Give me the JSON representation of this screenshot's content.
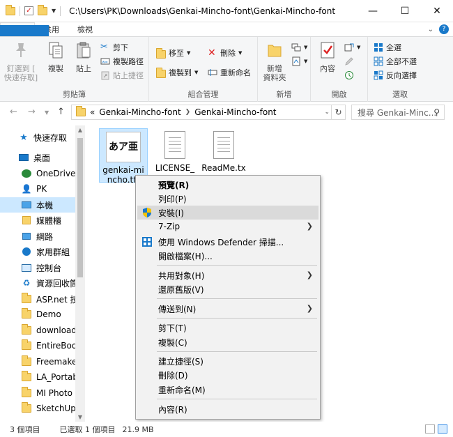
{
  "window": {
    "title": "C:\\Users\\PK\\Downloads\\Genkai-Mincho-font\\Genkai-Mincho-font",
    "minimize": "—",
    "maximize": "☐",
    "close": "✕"
  },
  "tabs": [
    "檔案",
    "常用",
    "共用",
    "檢視"
  ],
  "ribbon": {
    "clipboard": {
      "label": "剪貼簿",
      "pin": "釘選到[快速存取]",
      "pin_line1": "釘選到 [",
      "pin_line2": "快速存取]",
      "copy": "複製",
      "paste": "貼上",
      "cut": "剪下",
      "copy_path": "複製路徑",
      "paste_shortcut": "貼上捷徑"
    },
    "organize": {
      "label": "組合管理",
      "move_to": "移至",
      "copy_to": "複製到",
      "delete": "刪除",
      "rename": "重新命名"
    },
    "new": {
      "label": "新增",
      "new_folder_line1": "新增",
      "new_folder_line2": "資料夾"
    },
    "open": {
      "label": "開啟",
      "properties": "內容"
    },
    "select": {
      "label": "選取",
      "select_all": "全選",
      "select_none": "全部不選",
      "invert": "反向選擇"
    }
  },
  "address": {
    "overflow": "«",
    "crumbs": [
      "Genkai-Mincho-font",
      "Genkai-Mincho-font"
    ],
    "search_placeholder": "搜尋 Genkai-Minc...",
    "search_display": "搜尋 Genkai-Minc..."
  },
  "sidebar": {
    "items": [
      {
        "label": "快速存取",
        "icon": "star-icon"
      },
      {
        "label": "桌面",
        "icon": "desktop-icon"
      },
      {
        "label": "OneDrive",
        "icon": "onedrive-icon"
      },
      {
        "label": "PK",
        "icon": "user-icon"
      },
      {
        "label": "本機",
        "icon": "computer-icon"
      },
      {
        "label": "媒體櫃",
        "icon": "library-icon"
      },
      {
        "label": "網路",
        "icon": "network-icon"
      },
      {
        "label": "家用群組",
        "icon": "homegroup-icon"
      },
      {
        "label": "控制台",
        "icon": "control-panel-icon"
      },
      {
        "label": "資源回收筒",
        "icon": "recycle-bin-icon"
      },
      {
        "label": "ASP.net 技",
        "icon": "folder-icon"
      },
      {
        "label": "Demo",
        "icon": "folder-icon"
      },
      {
        "label": "download",
        "icon": "folder-icon"
      },
      {
        "label": "EntireBook",
        "icon": "folder-icon"
      },
      {
        "label": "Freemake_",
        "icon": "folder-icon"
      },
      {
        "label": "LA_Portabl",
        "icon": "folder-icon"
      },
      {
        "label": "MI Photo",
        "icon": "folder-icon"
      },
      {
        "label": "SketchUp",
        "icon": "folder-icon"
      }
    ]
  },
  "files": [
    {
      "name_line1": "genkai-mi",
      "name_line2": "ncho.ttf",
      "preview": "あア亜",
      "selected": true
    },
    {
      "name_line1": "LICENSE_",
      "name_line2": "",
      "selected": false
    },
    {
      "name_line1": "ReadMe.tx",
      "name_line2": "",
      "selected": false
    }
  ],
  "context_menu": {
    "items": [
      {
        "label": "預覽(R)"
      },
      {
        "label": "列印(P)"
      },
      {
        "label": "安裝(I)"
      },
      {
        "label": "7-Zip"
      },
      {
        "label": "使用 Windows Defender 掃描..."
      },
      {
        "label": "開啟檔案(H)..."
      },
      {
        "label": "共用對象(H)"
      },
      {
        "label": "還原舊版(V)"
      },
      {
        "label": "傳送到(N)"
      },
      {
        "label": "剪下(T)"
      },
      {
        "label": "複製(C)"
      },
      {
        "label": "建立捷徑(S)"
      },
      {
        "label": "刪除(D)"
      },
      {
        "label": "重新命名(M)"
      },
      {
        "label": "內容(R)"
      }
    ]
  },
  "status": {
    "count": "3 個項目",
    "selected": "已選取 1 個項目",
    "size": "21.9 MB"
  },
  "colors": {
    "accent": "#1979ca",
    "selection": "#cce8ff"
  }
}
